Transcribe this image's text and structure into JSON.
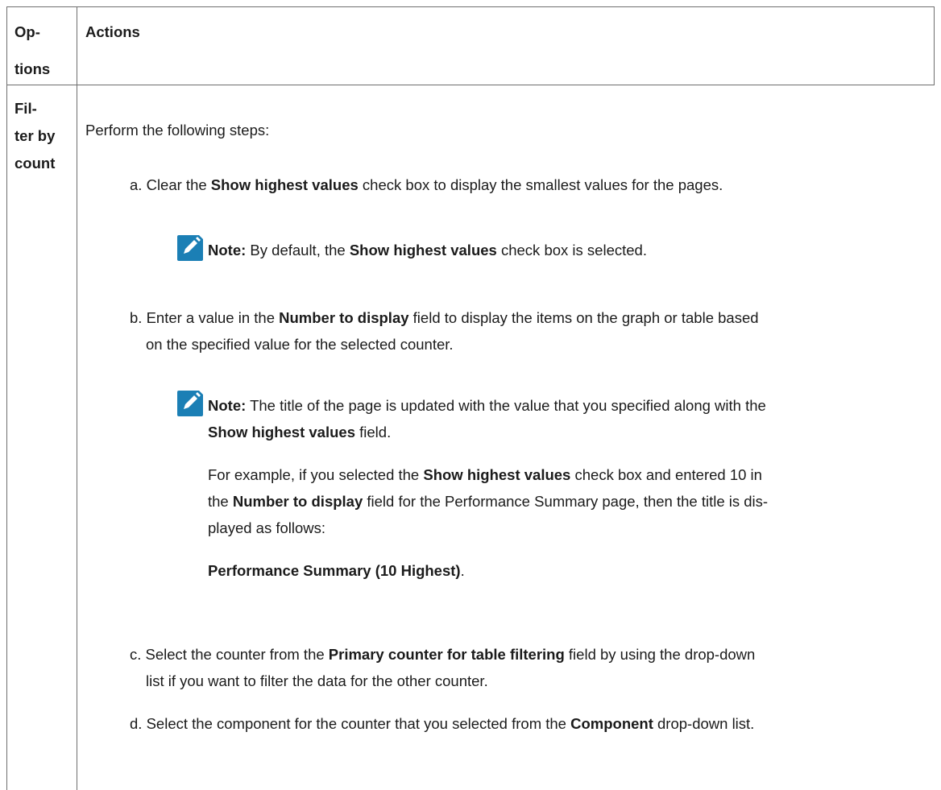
{
  "table": {
    "headers": {
      "options": [
        "Op-",
        "tions"
      ],
      "actions": "Actions"
    },
    "row": {
      "option": [
        "Fil-",
        "ter by",
        "count"
      ],
      "intro": "Perform the following steps:",
      "steps": [
        {
          "label": "a.",
          "parts": [
            "Clear the ",
            "Show highest values",
            " check box to display the smallest values for the pages."
          ]
        },
        {
          "label": "b.",
          "parts": [
            "Enter a value in the ",
            "Number to display",
            " field to display the items on the graph or table based"
          ],
          "line2": "on the specified value for the selected counter."
        },
        {
          "label": "c.",
          "parts": [
            "Select the counter from the ",
            "Primary counter for table filtering",
            " field by using the drop-down"
          ],
          "line2": "list if you want to filter the data for the other counter."
        },
        {
          "label": "d.",
          "parts": [
            "Select the component for the counter that you selected from the ",
            "Component",
            " drop-down list."
          ]
        }
      ],
      "note1": {
        "label": "Note:",
        "parts": [
          " By default, the ",
          "Show highest values",
          " check box is selected."
        ]
      },
      "note2": {
        "label": "Note:",
        "line1": " The title of the page is updated with the value that you specified along with the",
        "line2_bold": "Show highest values",
        "line2_rest": " field."
      },
      "example": {
        "l1": [
          "For example, if you selected the ",
          "Show highest values",
          " check box and entered 10 in"
        ],
        "l2": [
          "the ",
          "Number to display",
          " field for the Performance Summary page, then the title is dis-"
        ],
        "l3": "played as follows:",
        "title_bold": "Performance Summary (10 Highest)",
        "title_end": "."
      }
    }
  },
  "colors": {
    "note_icon": "#1b7fb5",
    "border": "#6e6e6e"
  },
  "icons": {
    "note": "pencil-note-icon"
  }
}
